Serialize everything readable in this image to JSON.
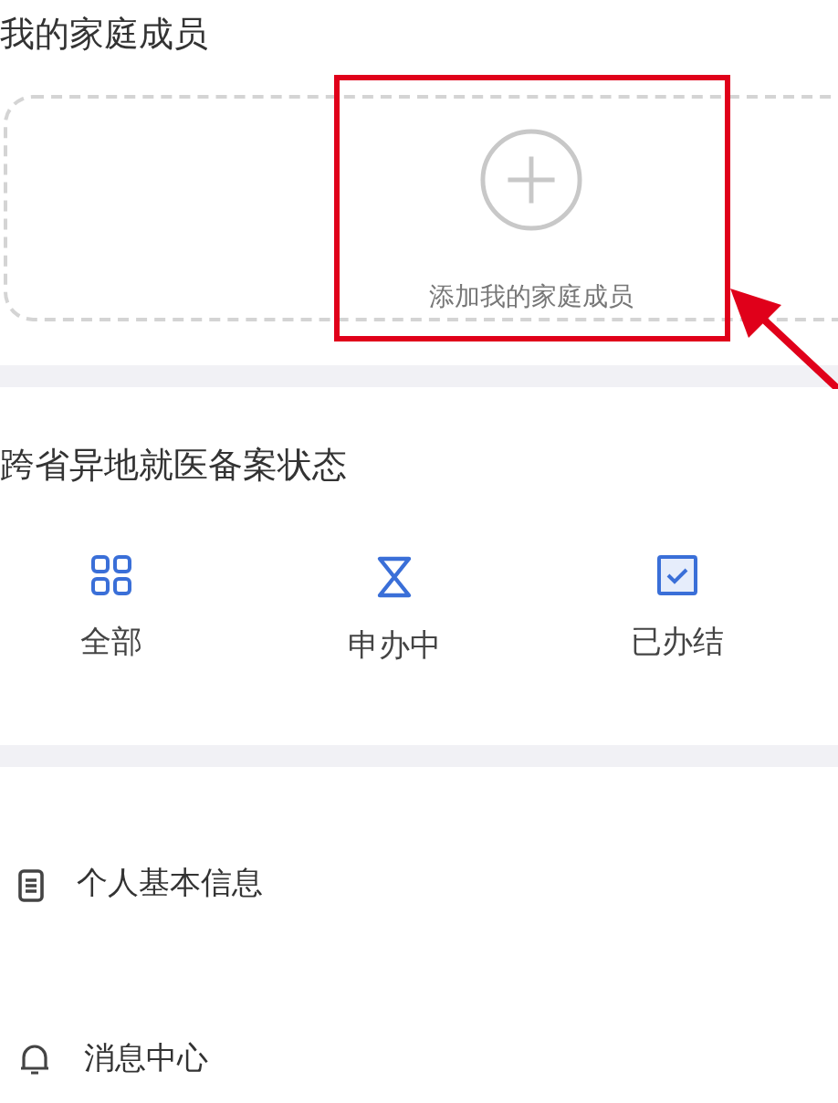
{
  "family": {
    "title": "我的家庭成员",
    "add_label": "添加我的家庭成员"
  },
  "filing_status": {
    "title": "跨省异地就医备案状态",
    "items": [
      {
        "kind": "all",
        "label": "全部"
      },
      {
        "kind": "pending",
        "label": "申办中"
      },
      {
        "kind": "done",
        "label": "已办结"
      }
    ]
  },
  "menu": [
    {
      "kind": "info",
      "label": "个人基本信息"
    },
    {
      "kind": "messages",
      "label": "消息中心"
    }
  ]
}
